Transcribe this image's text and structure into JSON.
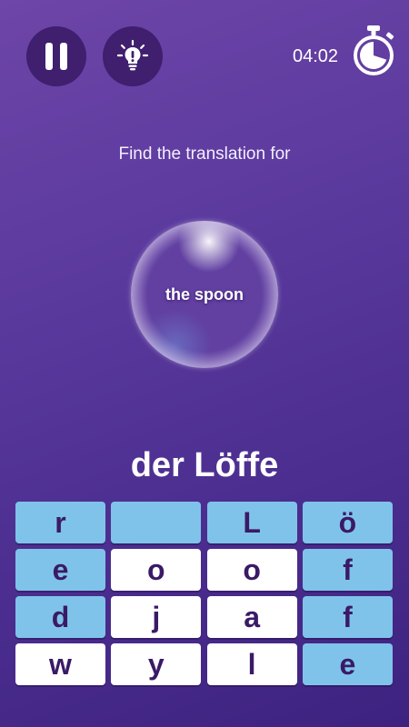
{
  "timer": {
    "time": "04:02",
    "elapsed_fraction": 0.3
  },
  "prompt": "Find the translation for",
  "bubble_word": "the spoon",
  "answer": "der Löffe",
  "colors": {
    "background_top": "#6e45a8",
    "background_bottom": "#3e2280",
    "button_bg": "#3f1f6e",
    "tile_used": "#7fc3ea",
    "tile_available": "#ffffff",
    "letter": "#3a1a66"
  },
  "icons": {
    "pause": "pause-icon",
    "hint": "lightbulb-icon",
    "timer": "stopwatch-icon"
  },
  "tiles": [
    {
      "letter": "r",
      "state": "used"
    },
    {
      "letter": "",
      "state": "used"
    },
    {
      "letter": "L",
      "state": "used"
    },
    {
      "letter": "ö",
      "state": "used"
    },
    {
      "letter": "e",
      "state": "used"
    },
    {
      "letter": "o",
      "state": "available"
    },
    {
      "letter": "o",
      "state": "available"
    },
    {
      "letter": "f",
      "state": "used"
    },
    {
      "letter": "d",
      "state": "used"
    },
    {
      "letter": "j",
      "state": "available"
    },
    {
      "letter": "a",
      "state": "available"
    },
    {
      "letter": "f",
      "state": "used"
    },
    {
      "letter": "w",
      "state": "available"
    },
    {
      "letter": "y",
      "state": "available"
    },
    {
      "letter": "l",
      "state": "available"
    },
    {
      "letter": "e",
      "state": "used"
    }
  ]
}
